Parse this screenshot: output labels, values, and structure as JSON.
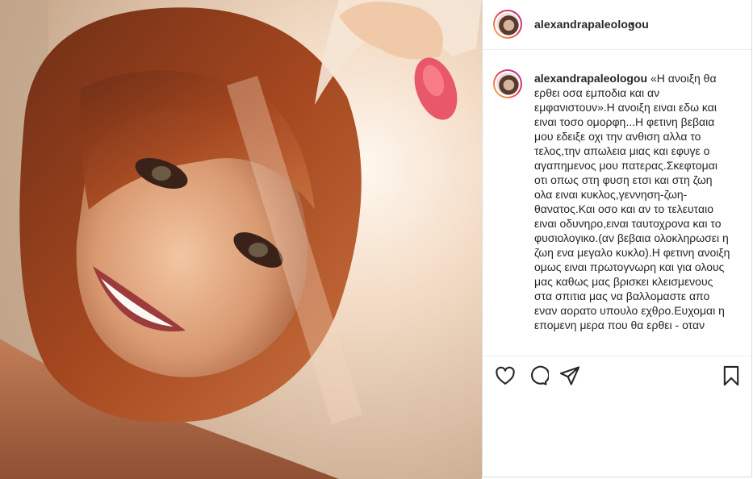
{
  "post": {
    "username": "alexandrapaleologou",
    "header_separator": "•",
    "caption": "«Η ανοιξη θα ερθει οσα εμποδια και αν εμφανιστουν».Η ανοιξη ειναι εδω και ειναι τοσο ομορφη...Η φετινη βεβαια μου εδειξε οχι την ανθιση αλλα το τελος,την απωλεια μιας και εφυγε ο αγαπημενος μου πατερας.Σκεφτομαι οτι οπως στη φυση ετσι και στη ζωη ολα ειναι κυκλος,γεννηση-ζωη-θανατος.Και οσο και αν το τελευταιο ειναι οδυνηρο,ειναι ταυτοχρονα και το φυσιολογικο.(αν βεβαια ολοκληρωσει η ζωη ενα μεγαλο κυκλο).Η φετινη ανοιξη ομως ειναι πρωτογνωρη και για ολους μας καθως μας βρισκει κλεισμενους στα σπιτια μας να βαλλομαστε απο εναν αορατο υπουλο εχθρο.Ευχομαι η επομενη μερα που θα ερθει - οταν"
  },
  "actions": {
    "like_icon": "heart-outline",
    "comment_icon": "speech-bubble-outline",
    "share_icon": "paper-plane-outline",
    "save_icon": "bookmark-outline"
  },
  "colors": {
    "text": "#262626",
    "border": "#dbdbdb",
    "story_ring_start": "#f9c04a",
    "story_ring_end": "#b22d9c"
  }
}
